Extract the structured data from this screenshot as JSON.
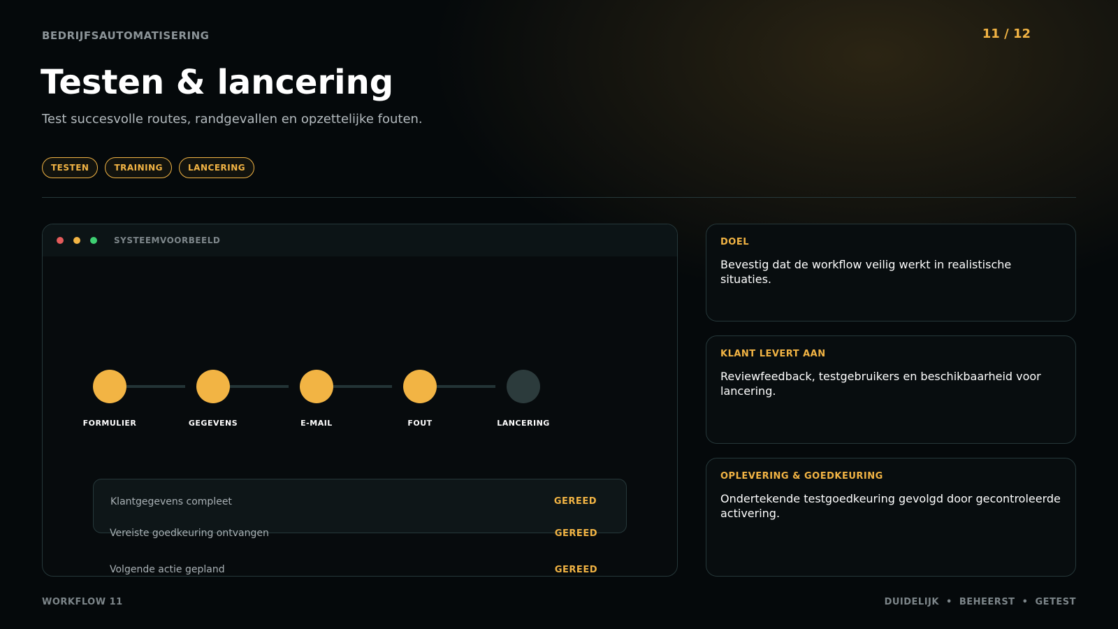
{
  "header": {
    "eyebrow": "BEDRIJFSAUTOMATISERING",
    "page": "11 / 12",
    "title": "Testen & lancering",
    "subtitle": "Test succesvolle routes, randgevallen en opzettelijke fouten."
  },
  "tags": [
    "TESTEN",
    "TRAINING",
    "LANCERING"
  ],
  "preview": {
    "label": "SYSTEEMVOORBEELD",
    "steps": [
      {
        "label": "FORMULIER",
        "state": "done"
      },
      {
        "label": "GEGEVENS",
        "state": "done"
      },
      {
        "label": "E-MAIL",
        "state": "done"
      },
      {
        "label": "FOUT",
        "state": "done"
      },
      {
        "label": "LANCERING",
        "state": "todo"
      }
    ],
    "checklist": [
      {
        "text": "Klantgegevens compleet",
        "status": "GEREED"
      },
      {
        "text": "Vereiste goedkeuring ontvangen",
        "status": "GEREED"
      },
      {
        "text": "Volgende actie gepland",
        "status": "GEREED"
      }
    ]
  },
  "cards": [
    {
      "label": "DOEL",
      "text": "Bevestig dat de workflow veilig werkt in realistische situaties."
    },
    {
      "label": "KLANT LEVERT AAN",
      "text": "Reviewfeedback, testgebruikers en beschikbaarheid voor lancering."
    },
    {
      "label": "OPLEVERING & GOEDKEURING",
      "text": "Ondertekende testgoedkeuring gevolgd door gecontroleerde activering."
    }
  ],
  "footer": {
    "left": "WORKFLOW 11",
    "right": "DUIDELIJK  •  BEHEERST  •  GETEST"
  },
  "colors": {
    "accent": "#f2b444",
    "background": "#05090b",
    "border": "#26383a",
    "inactive_step": "#2c3b3c"
  }
}
